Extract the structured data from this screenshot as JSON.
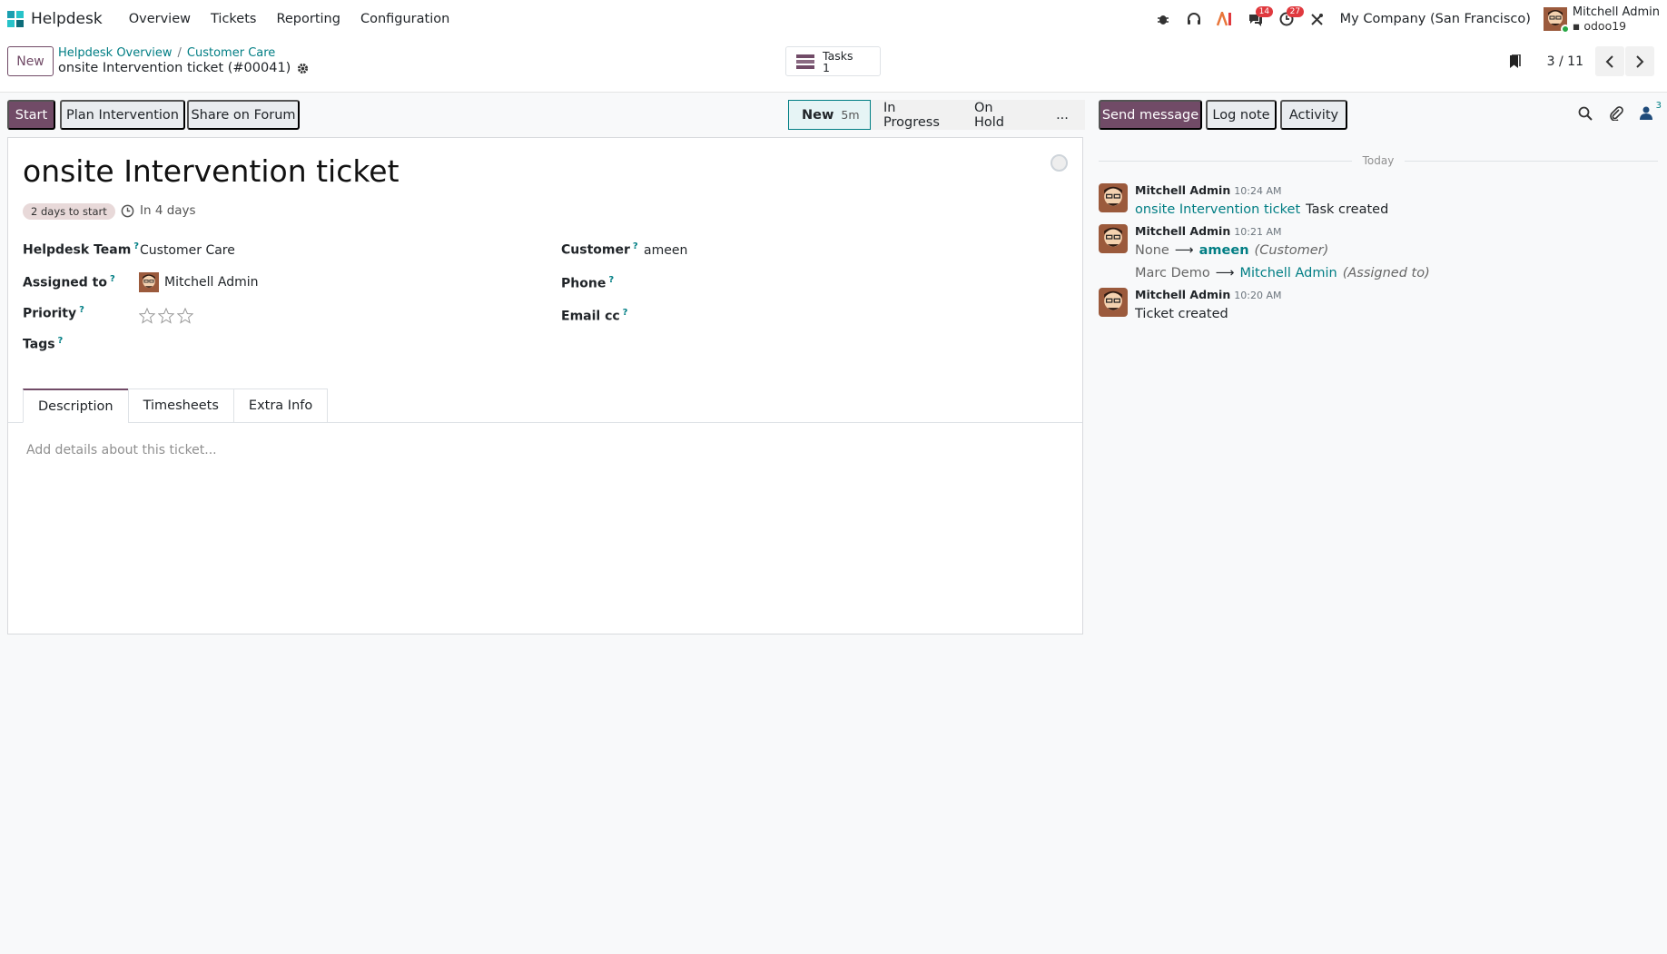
{
  "app": {
    "name": "Helpdesk",
    "menu": [
      "Overview",
      "Tickets",
      "Reporting",
      "Configuration"
    ],
    "colors": {
      "brand": "#714b67",
      "link": "#017e84",
      "badge": "#e0393e"
    }
  },
  "systray": {
    "messages_count": "14",
    "activities_count": "27",
    "company": "My Company (San Francisco)",
    "user_name": "Mitchell Admin",
    "db_name": "odoo19"
  },
  "control": {
    "new_label": "New",
    "breadcrumb": [
      "Helpdesk Overview",
      "Customer Care"
    ],
    "record_title": "onsite Intervention ticket (#00041)",
    "smart_button": {
      "label": "Tasks",
      "count": "1"
    },
    "pager": "3 / 11"
  },
  "actions": {
    "start": "Start",
    "plan": "Plan Intervention",
    "share": "Share on Forum"
  },
  "stages": {
    "current": "New",
    "current_time": "5m",
    "others": [
      "In Progress",
      "On Hold",
      "..."
    ]
  },
  "form": {
    "title": "onsite Intervention ticket",
    "days_badge": "2 days to start",
    "deadline": "In 4 days",
    "labels": {
      "team": "Helpdesk Team",
      "assigned": "Assigned to",
      "priority": "Priority",
      "tags": "Tags",
      "customer": "Customer",
      "phone": "Phone",
      "email_cc": "Email cc"
    },
    "help_mark": "?",
    "values": {
      "team": "Customer Care",
      "assigned": "Mitchell Admin",
      "customer": "ameen",
      "priority_stars": 0
    },
    "tabs": [
      "Description",
      "Timesheets",
      "Extra Info"
    ],
    "description_placeholder": "Add details about this ticket..."
  },
  "chatter": {
    "send_message": "Send message",
    "log_note": "Log note",
    "activity": "Activity",
    "followers_count": "3",
    "today": "Today",
    "messages": [
      {
        "author": "Mitchell Admin",
        "time": "10:24 AM",
        "link": "onsite Intervention ticket",
        "text": "Task created"
      },
      {
        "author": "Mitchell Admin",
        "time": "10:21 AM",
        "change1_old": "None",
        "change1_new": "ameen",
        "change1_field": "(Customer)",
        "change2_old": "Marc Demo",
        "change2_new": "Mitchell Admin",
        "change2_field": "(Assigned to)"
      },
      {
        "author": "Mitchell Admin",
        "time": "10:20 AM",
        "text": "Ticket created"
      }
    ]
  }
}
